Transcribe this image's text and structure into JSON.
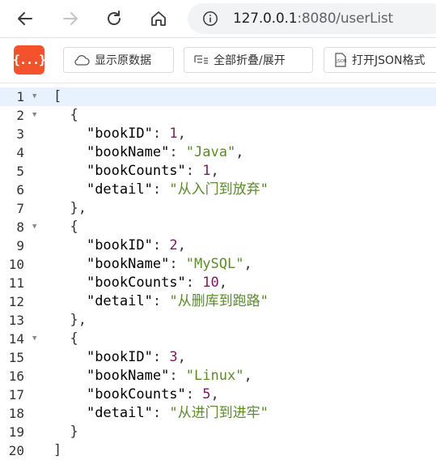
{
  "browser": {
    "url_host": "127.0.0.1",
    "url_rest": ":8080/userList",
    "icons": [
      "back-arrow-icon",
      "forward-arrow-icon",
      "reload-icon",
      "home-icon",
      "info-icon"
    ]
  },
  "viewer_toolbar": {
    "logo_text": "{...}",
    "buttons": [
      {
        "label": "显示原数据",
        "icon": "cloud-icon"
      },
      {
        "label": "全部折叠/展开",
        "icon": "collapse-icon"
      },
      {
        "label": "打开JSON格式",
        "icon": "json-file-icon"
      }
    ],
    "logo_color": "#f4522d"
  },
  "code": {
    "lines": [
      {
        "n": "1",
        "fold": true,
        "indent": 0,
        "parts": [
          [
            "punc",
            "["
          ]
        ]
      },
      {
        "n": "2",
        "fold": true,
        "indent": 1,
        "parts": [
          [
            "punc",
            "{"
          ]
        ]
      },
      {
        "n": "3",
        "fold": false,
        "indent": 2,
        "parts": [
          [
            "key",
            "\"bookID\""
          ],
          [
            "punc",
            ": "
          ],
          [
            "num",
            "1"
          ],
          [
            "punc",
            ","
          ]
        ]
      },
      {
        "n": "4",
        "fold": false,
        "indent": 2,
        "parts": [
          [
            "key",
            "\"bookName\""
          ],
          [
            "punc",
            ": "
          ],
          [
            "str",
            "\"Java\""
          ],
          [
            "punc",
            ","
          ]
        ]
      },
      {
        "n": "5",
        "fold": false,
        "indent": 2,
        "parts": [
          [
            "key",
            "\"bookCounts\""
          ],
          [
            "punc",
            ": "
          ],
          [
            "num",
            "1"
          ],
          [
            "punc",
            ","
          ]
        ]
      },
      {
        "n": "6",
        "fold": false,
        "indent": 2,
        "parts": [
          [
            "key",
            "\"detail\""
          ],
          [
            "punc",
            ": "
          ],
          [
            "str",
            "\"从入门到放弃\""
          ]
        ]
      },
      {
        "n": "7",
        "fold": false,
        "indent": 1,
        "parts": [
          [
            "punc",
            "},"
          ]
        ]
      },
      {
        "n": "8",
        "fold": true,
        "indent": 1,
        "parts": [
          [
            "punc",
            "{"
          ]
        ]
      },
      {
        "n": "9",
        "fold": false,
        "indent": 2,
        "parts": [
          [
            "key",
            "\"bookID\""
          ],
          [
            "punc",
            ": "
          ],
          [
            "num",
            "2"
          ],
          [
            "punc",
            ","
          ]
        ]
      },
      {
        "n": "10",
        "fold": false,
        "indent": 2,
        "parts": [
          [
            "key",
            "\"bookName\""
          ],
          [
            "punc",
            ": "
          ],
          [
            "str",
            "\"MySQL\""
          ],
          [
            "punc",
            ","
          ]
        ]
      },
      {
        "n": "11",
        "fold": false,
        "indent": 2,
        "parts": [
          [
            "key",
            "\"bookCounts\""
          ],
          [
            "punc",
            ": "
          ],
          [
            "num",
            "10"
          ],
          [
            "punc",
            ","
          ]
        ]
      },
      {
        "n": "12",
        "fold": false,
        "indent": 2,
        "parts": [
          [
            "key",
            "\"detail\""
          ],
          [
            "punc",
            ": "
          ],
          [
            "str",
            "\"从删库到跑路\""
          ]
        ]
      },
      {
        "n": "13",
        "fold": false,
        "indent": 1,
        "parts": [
          [
            "punc",
            "},"
          ]
        ]
      },
      {
        "n": "14",
        "fold": true,
        "indent": 1,
        "parts": [
          [
            "punc",
            "{"
          ]
        ]
      },
      {
        "n": "15",
        "fold": false,
        "indent": 2,
        "parts": [
          [
            "key",
            "\"bookID\""
          ],
          [
            "punc",
            ": "
          ],
          [
            "num",
            "3"
          ],
          [
            "punc",
            ","
          ]
        ]
      },
      {
        "n": "16",
        "fold": false,
        "indent": 2,
        "parts": [
          [
            "key",
            "\"bookName\""
          ],
          [
            "punc",
            ": "
          ],
          [
            "str",
            "\"Linux\""
          ],
          [
            "punc",
            ","
          ]
        ]
      },
      {
        "n": "17",
        "fold": false,
        "indent": 2,
        "parts": [
          [
            "key",
            "\"bookCounts\""
          ],
          [
            "punc",
            ": "
          ],
          [
            "num",
            "5"
          ],
          [
            "punc",
            ","
          ]
        ]
      },
      {
        "n": "18",
        "fold": false,
        "indent": 2,
        "parts": [
          [
            "key",
            "\"detail\""
          ],
          [
            "punc",
            ": "
          ],
          [
            "str",
            "\"从进门到进牢\""
          ]
        ]
      },
      {
        "n": "19",
        "fold": false,
        "indent": 1,
        "parts": [
          [
            "punc",
            "}"
          ]
        ]
      },
      {
        "n": "20",
        "fold": false,
        "indent": 0,
        "parts": [
          [
            "punc",
            "]"
          ]
        ]
      }
    ],
    "active_line": "1",
    "colors": {
      "number": "#7a1a5c",
      "string": "#5a8c2a",
      "active_line_bg": "#e8f2ff"
    }
  }
}
